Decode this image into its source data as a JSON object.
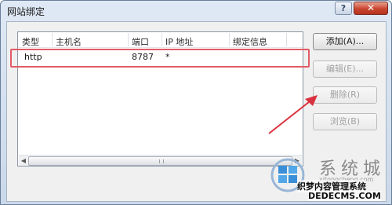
{
  "window": {
    "title": "网站绑定",
    "help_label": "?",
    "close_label": "✕"
  },
  "bindings_table": {
    "columns": [
      "类型",
      "主机名",
      "端口",
      "IP 地址",
      "绑定信息"
    ],
    "rows": [
      {
        "type": "http",
        "hostname": "",
        "port": "8787",
        "ip": "*",
        "info": ""
      }
    ]
  },
  "buttons": {
    "add": "添加(A)...",
    "edit": "编辑(E)...",
    "remove": "删除(R)",
    "browse": "浏览(B)"
  },
  "annotation": {
    "highlight_color": "#e25b66",
    "arrow_color": "#d9333f"
  },
  "watermark": {
    "big_text": "系统城",
    "small_text": "xitongcheng.com",
    "line1": "织梦内容管理系统",
    "line2": "DEDECMS.COM"
  }
}
